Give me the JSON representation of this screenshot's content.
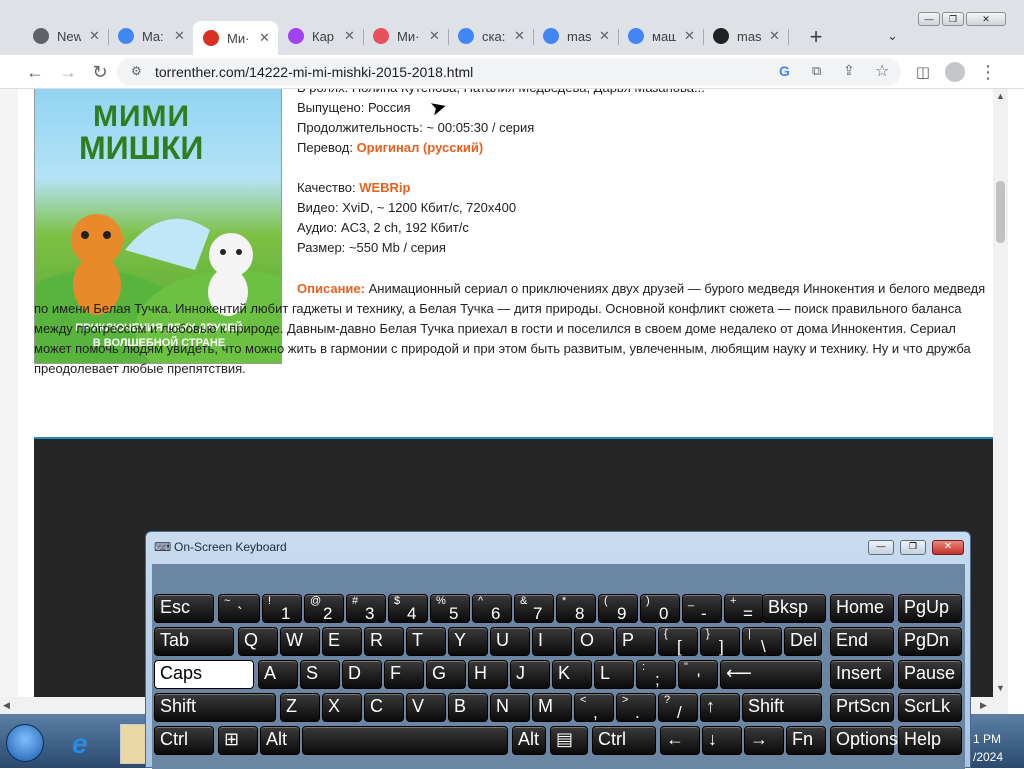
{
  "tabs": [
    {
      "title": "New",
      "icon": "chrome-icon",
      "color": "#5f6368"
    },
    {
      "title": "Ma:",
      "icon": "google-icon",
      "color": "#4285f4"
    },
    {
      "title": "Mи·",
      "icon": "torrent-site-icon",
      "color": "#d93025",
      "active": true
    },
    {
      "title": "Кар",
      "icon": "colorful-flower-icon",
      "color": "#a142f4"
    },
    {
      "title": "Ми·",
      "icon": "book-icon",
      "color": "#e8505b"
    },
    {
      "title": "ска:",
      "icon": "google-icon",
      "color": "#4285f4"
    },
    {
      "title": "mas",
      "icon": "google-icon",
      "color": "#4285f4"
    },
    {
      "title": "маш",
      "icon": "google-icon",
      "color": "#4285f4"
    },
    {
      "title": "mas",
      "icon": "museum-icon",
      "color": "#202124"
    }
  ],
  "new_tab": "+",
  "url": "torrenther.com/14222-mi-mi-mishki-2015-2018.html",
  "poster": {
    "title_line1": "МИМИ",
    "title_line2": "МИШКИ",
    "caption_line1": "ПРИКЛЮЧЕНИЯ ДВУХ ДРУЗЕЙ",
    "caption_line2": "В ВОЛШЕБНОЙ СТРАНЕ"
  },
  "info": [
    {
      "label": "В ролях: ",
      "value": "Полина Кутепова, Наталия Медведева, Дарья Мазанова...",
      "hl": false
    },
    {
      "label": "Выпущено: ",
      "value": "Россия",
      "hl": false
    },
    {
      "label": "Продолжительность: ",
      "value": "~ 00:05:30 / серия",
      "hl": false
    },
    {
      "label": "Перевод: ",
      "value": "Оригинал (русский)",
      "hl": true
    },
    {
      "label": "Качество: ",
      "value": "WEBRip",
      "hl": true
    },
    {
      "label": "Видео: ",
      "value": "XviD, ~ 1200 Кбит/с, 720x400",
      "hl": false
    },
    {
      "label": "Аудио: ",
      "value": "AC3, 2 ch, 192 Кбит/с",
      "hl": false
    },
    {
      "label": "Размер: ",
      "value": "~550 Mb / серия",
      "hl": false
    }
  ],
  "desc": {
    "label": "Описание:",
    "text": " Анимационный сериал о приключениях двух друзей — бурого медведя Иннокентия и белого медведя по имени Белая Тучка. Иннокентий любит гаджеты и технику, а Белая Тучка — дитя природы. Основной конфликт сюжета — поиск правильного баланса между прогрессом и любовью к природе. Давным-давно Белая Тучка приехал в гости и поселился в своем доме недалеко от дома Иннокентия. Сериал может помочь людям увидеть, что можно жить в гармонии с природой и при этом быть развитым, увлеченным, любящим науку и технику. Ну и что дружба преодолевает любые препятствия."
  },
  "osk": {
    "title": "On-Screen Keyboard",
    "rows": [
      [
        {
          "m": "Esc"
        },
        {
          "u": "~",
          "l": "`"
        },
        {
          "u": "!",
          "l": "1"
        },
        {
          "u": "@",
          "l": "2"
        },
        {
          "u": "#",
          "l": "3"
        },
        {
          "u": "$",
          "l": "4"
        },
        {
          "u": "%",
          "l": "5"
        },
        {
          "u": "^",
          "l": "6"
        },
        {
          "u": "&",
          "l": "7"
        },
        {
          "u": "*",
          "l": "8"
        },
        {
          "u": "(",
          "l": "9"
        },
        {
          "u": ")",
          "l": "0"
        },
        {
          "u": "_",
          "l": "-"
        },
        {
          "u": "+",
          "l": "="
        },
        {
          "m": "Bksp"
        },
        {
          "m": "Home"
        },
        {
          "m": "PgUp"
        }
      ],
      [
        {
          "m": "Tab"
        },
        {
          "m": "Q"
        },
        {
          "m": "W"
        },
        {
          "m": "E"
        },
        {
          "m": "R"
        },
        {
          "m": "T"
        },
        {
          "m": "Y"
        },
        {
          "m": "U"
        },
        {
          "m": "I"
        },
        {
          "m": "O"
        },
        {
          "m": "P"
        },
        {
          "u": "{",
          "l": "["
        },
        {
          "u": "}",
          "l": "]"
        },
        {
          "u": "|",
          "l": "\\"
        },
        {
          "m": "Del"
        },
        {
          "m": "End"
        },
        {
          "m": "PgDn"
        }
      ],
      [
        {
          "m": "Caps",
          "caps": true
        },
        {
          "m": "A"
        },
        {
          "m": "S"
        },
        {
          "m": "D"
        },
        {
          "m": "F"
        },
        {
          "m": "G"
        },
        {
          "m": "H"
        },
        {
          "m": "J"
        },
        {
          "m": "K"
        },
        {
          "m": "L"
        },
        {
          "u": ":",
          "l": ";"
        },
        {
          "u": "\"",
          "l": "'"
        },
        {
          "m": "⟵"
        },
        {
          "m": "Insert"
        },
        {
          "m": "Pause"
        }
      ],
      [
        {
          "m": "Shift"
        },
        {
          "m": "Z"
        },
        {
          "m": "X"
        },
        {
          "m": "C"
        },
        {
          "m": "V"
        },
        {
          "m": "B"
        },
        {
          "m": "N"
        },
        {
          "m": "M"
        },
        {
          "u": "<",
          "l": ","
        },
        {
          "u": ">",
          "l": "."
        },
        {
          "u": "?",
          "l": "/"
        },
        {
          "m": "↑"
        },
        {
          "m": "Shift"
        },
        {
          "m": "PrtScn"
        },
        {
          "m": "ScrLk"
        }
      ],
      [
        {
          "m": "Ctrl"
        },
        {
          "m": "⊞"
        },
        {
          "m": "Alt"
        },
        {
          "m": ""
        },
        {
          "m": "Alt"
        },
        {
          "m": "▤"
        },
        {
          "m": "Ctrl"
        },
        {
          "m": "←"
        },
        {
          "m": "↓"
        },
        {
          "m": "→"
        },
        {
          "m": "Fn"
        },
        {
          "m": "Options"
        },
        {
          "m": "Help"
        }
      ]
    ]
  },
  "clock": {
    "time": "1 PM",
    "date": "/2024"
  }
}
